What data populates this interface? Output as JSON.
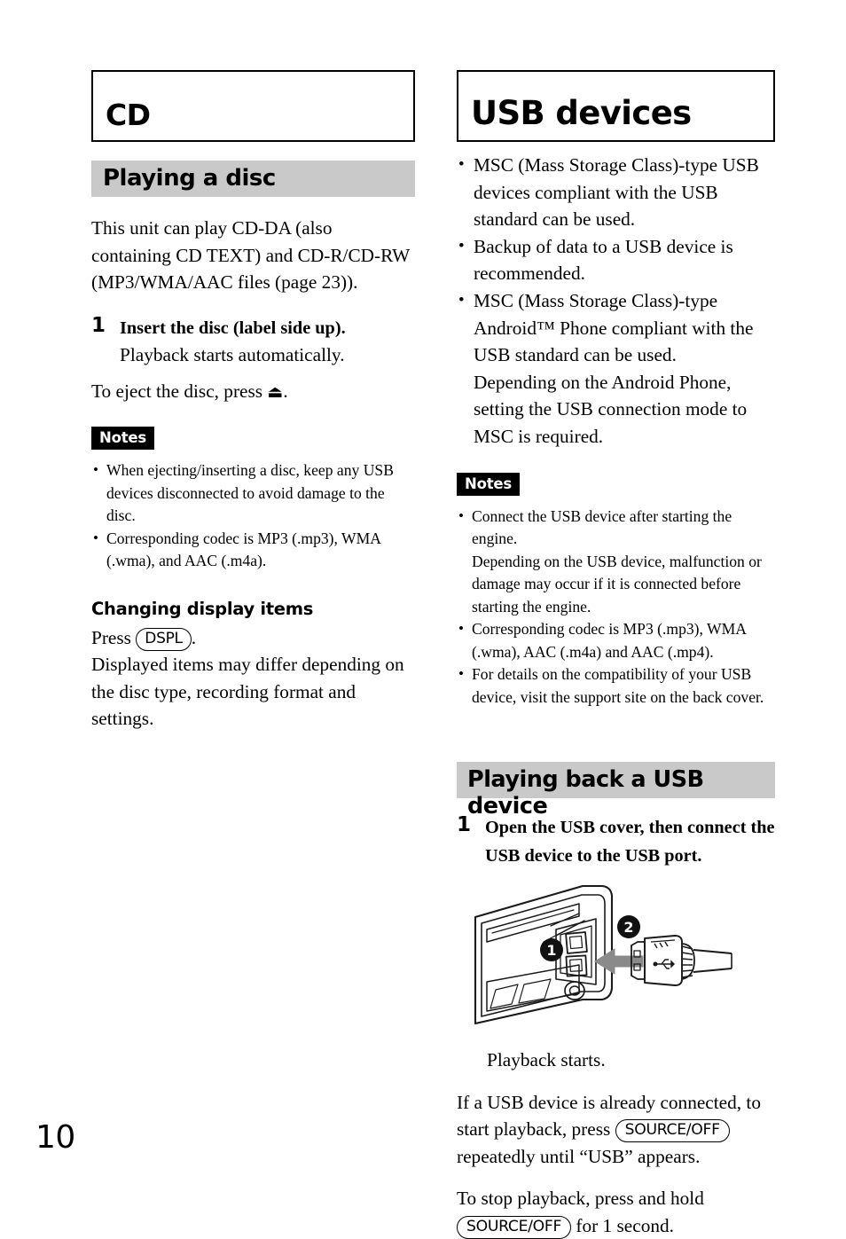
{
  "page": {
    "number": "10"
  },
  "left_column": {
    "chapter_title": "CD",
    "section_title": "Playing a disc",
    "intro": "This unit can play CD-DA (also containing CD TEXT) and CD-R/CD-RW (MP3/WMA/AAC files (page 23)).",
    "step1": {
      "number": "1",
      "title": "Insert the disc (label side up).",
      "body": "Playback starts automatically."
    },
    "eject_line_before": "To eject the disc, press ",
    "eject_icon": "eject-symbol",
    "eject_glyph": "⏏",
    "eject_line_after": ".",
    "notes_label": "Notes",
    "notes": [
      "When ejecting/inserting a disc, keep any USB devices disconnected to avoid damage to the disc.",
      "Corresponding codec is MP3 (.mp3), WMA (.wma), and AAC (.m4a)."
    ],
    "subsection_title": "Changing display items",
    "press_prefix": "Press ",
    "dspl_key": "DSPL",
    "press_suffix": ".",
    "display_note": "Displayed items may differ depending on the disc type, recording format and settings."
  },
  "right_column": {
    "chapter_title": "USB devices",
    "bullets": [
      "MSC (Mass Storage Class)-type USB devices compliant with the USB standard can be used.",
      "Backup of data to a USB device is recommended."
    ],
    "bullet_android_main": "MSC (Mass Storage Class)-type Android™ Phone compliant with the USB standard can be used.",
    "bullet_android_sub": "Depending on the Android Phone, setting the USB connection mode to MSC is required.",
    "notes_label": "Notes",
    "note_connect_main": "Connect the USB device after starting the engine.",
    "note_connect_sub": "Depending on the USB device, malfunction or damage may occur if it is connected before starting the engine.",
    "note_codec": "Corresponding codec is MP3 (.mp3), WMA (.wma), AAC (.m4a) and AAC (.mp4).",
    "note_support": "For details on the compatibility of your USB device, visit the support site on the back cover.",
    "section_title": "Playing back a USB device",
    "step1": {
      "number": "1",
      "title": "Open the USB cover, then connect the USB device to the USB port."
    },
    "illustration": {
      "name": "usb-connection-diagram",
      "callout_1": "1",
      "callout_2": "2"
    },
    "playback_starts": "Playback starts.",
    "already_connected_prefix": "If a USB device is already connected, to start playback, press ",
    "source_off_key": "SOURCE/OFF",
    "already_connected_suffix": " repeatedly until “USB” appears.",
    "stop_prefix": "To stop playback, press and hold",
    "stop_suffix": " for 1 second."
  },
  "colors": {
    "section_bar": "#c9c9c9",
    "notes_badge_bg": "#000000",
    "arrow_gray": "#8a8a8a"
  }
}
